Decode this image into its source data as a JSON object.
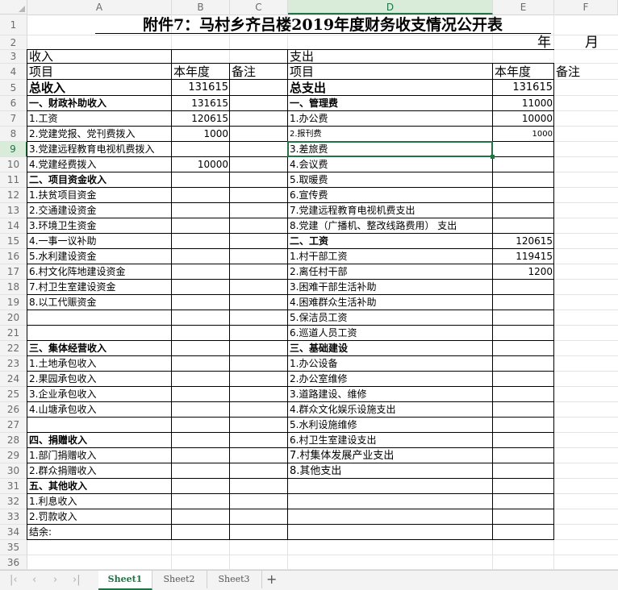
{
  "columns": [
    "A",
    "B",
    "C",
    "D",
    "E",
    "F"
  ],
  "selected_cell": "D9",
  "sheet": {
    "title": "附件7：马村乡齐吕楼2019年度财务收支情况公开表",
    "year_label": "年",
    "month_label": "月",
    "row3": {
      "left": "收入",
      "right": "支出"
    },
    "row4": {
      "item": "项目",
      "current_year": "本年度",
      "remark": "备注"
    },
    "income": [
      {
        "label": "总收入",
        "value": "131615",
        "style": "big"
      },
      {
        "label": "一、财政补助收入",
        "value": "131615",
        "style": "bold"
      },
      {
        "label": "1.工资",
        "value": "120615"
      },
      {
        "label": "2.党建党报、党刊费拨入",
        "value": "1000"
      },
      {
        "label": "3.党建远程教育电视机费拨入",
        "value": ""
      },
      {
        "label": "4.党建经费拨入",
        "value": "10000"
      },
      {
        "label": "二、项目资金收入",
        "value": "",
        "style": "bold"
      },
      {
        "label": "1.扶贫项目资金",
        "value": ""
      },
      {
        "label": "2.交通建设资金",
        "value": ""
      },
      {
        "label": "3.环境卫生资金",
        "value": ""
      },
      {
        "label": "4.一事一议补助",
        "value": ""
      },
      {
        "label": "5.水利建设资金",
        "value": ""
      },
      {
        "label": "6.村文化阵地建设资金",
        "value": ""
      },
      {
        "label": "7.村卫生室建设资金",
        "value": ""
      },
      {
        "label": "8.以工代赈资金",
        "value": ""
      },
      {
        "label": "",
        "value": ""
      },
      {
        "label": "",
        "value": ""
      },
      {
        "label": "三、集体经营收入",
        "value": "",
        "style": "bold"
      },
      {
        "label": "1.土地承包收入",
        "value": ""
      },
      {
        "label": "2.果园承包收入",
        "value": ""
      },
      {
        "label": "3.企业承包收入",
        "value": ""
      },
      {
        "label": "4.山塘承包收入",
        "value": ""
      },
      {
        "label": "",
        "value": ""
      },
      {
        "label": "四、捐赠收入",
        "value": "",
        "style": "bold"
      },
      {
        "label": "1.部门捐赠收入",
        "value": ""
      },
      {
        "label": "2.群众捐赠收入",
        "value": ""
      },
      {
        "label": "五、其他收入",
        "value": "",
        "style": "bold"
      },
      {
        "label": "1.利息收入",
        "value": ""
      },
      {
        "label": "2.罚款收入",
        "value": ""
      },
      {
        "label": "结余:",
        "value": ""
      }
    ],
    "expense": [
      {
        "label": "总支出",
        "value": "131615",
        "style": "big"
      },
      {
        "label": "一、管理费",
        "value": "11000",
        "style": "bold"
      },
      {
        "label": "1.办公费",
        "value": "10000"
      },
      {
        "label": "2.报刊费",
        "value": "1000",
        "style": "small"
      },
      {
        "label": "3.差旅费",
        "value": ""
      },
      {
        "label": "4.会议费",
        "value": ""
      },
      {
        "label": "5.取暖费",
        "value": ""
      },
      {
        "label": "6.宣传费",
        "value": ""
      },
      {
        "label": "7.党建远程教育电视机费支出",
        "value": ""
      },
      {
        "label": "8.党建（广播机、整改线路费用） 支出",
        "value": ""
      },
      {
        "label": "二、工资",
        "value": "120615",
        "style": "bold"
      },
      {
        "label": "1.村干部工资",
        "value": "119415"
      },
      {
        "label": "2.离任村干部",
        "value": "1200"
      },
      {
        "label": "3.困难干部生活补助",
        "value": ""
      },
      {
        "label": "4.困难群众生活补助",
        "value": ""
      },
      {
        "label": "5.保洁员工资",
        "value": ""
      },
      {
        "label": "6.巡道人员工资",
        "value": ""
      },
      {
        "label": "三、基础建设",
        "value": "",
        "style": "bold"
      },
      {
        "label": "1.办公设备",
        "value": ""
      },
      {
        "label": "2.办公室维修",
        "value": ""
      },
      {
        "label": "3.道路建设、维修",
        "value": ""
      },
      {
        "label": "4.群众文化娱乐设施支出",
        "value": ""
      },
      {
        "label": "5.水利设施维修",
        "value": ""
      },
      {
        "label": "6.村卫生室建设支出",
        "value": ""
      },
      {
        "label": "7.村集体发展产业支出",
        "value": "",
        "style": "med"
      },
      {
        "label": "8.其他支出",
        "value": "",
        "style": "med"
      },
      {
        "label": "",
        "value": ""
      },
      {
        "label": "",
        "value": ""
      },
      {
        "label": "",
        "value": ""
      },
      {
        "label": "",
        "value": ""
      }
    ]
  },
  "row_numbers": [
    "1",
    "2",
    "3",
    "4",
    "5",
    "6",
    "7",
    "8",
    "9",
    "10",
    "11",
    "12",
    "13",
    "14",
    "15",
    "16",
    "17",
    "18",
    "19",
    "20",
    "21",
    "22",
    "23",
    "24",
    "25",
    "26",
    "27",
    "28",
    "29",
    "30",
    "31",
    "32",
    "33",
    "34",
    "35",
    "36"
  ],
  "sheet_tabs": [
    "Sheet1",
    "Sheet2",
    "Sheet3"
  ],
  "active_tab": "Sheet1",
  "add_tab_icon": "plus-icon",
  "nav_icons": [
    "first-sheet-icon",
    "prev-sheet-icon",
    "next-sheet-icon",
    "last-sheet-icon"
  ],
  "colors": {
    "accent": "#217346",
    "header_bg": "#f3f3f3",
    "grid": "#e3e3e3"
  }
}
